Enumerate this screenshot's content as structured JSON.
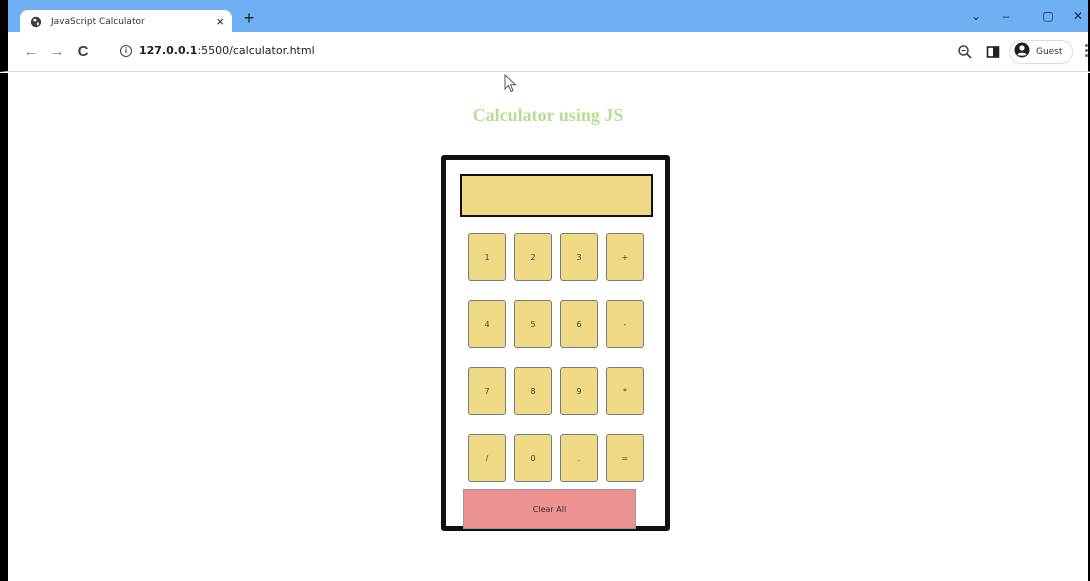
{
  "browser": {
    "tab_title": "JavaScript Calculator",
    "tab_close": "×",
    "new_tab": "+",
    "url_host": "127.0.0.1",
    "url_path": ":5500/calculator.html",
    "profile_label": "Guest",
    "menu": "⋮",
    "back": "←",
    "forward": "→",
    "reload": "C",
    "minimize": "–",
    "maximize": "▢",
    "close": "✕",
    "chevron": "⌄"
  },
  "page": {
    "title": "Calculator using JS"
  },
  "calculator": {
    "display_value": "",
    "keys": [
      "1",
      "2",
      "3",
      "+",
      "4",
      "5",
      "6",
      "-",
      "7",
      "8",
      "9",
      "*",
      "/",
      "0",
      ".",
      "="
    ],
    "clear_label": "Clear All"
  },
  "colors": {
    "title": "#b5df92",
    "key": "#eed985",
    "clear": "#ee9191",
    "chrome_titlebar": "#6fb0f5"
  }
}
